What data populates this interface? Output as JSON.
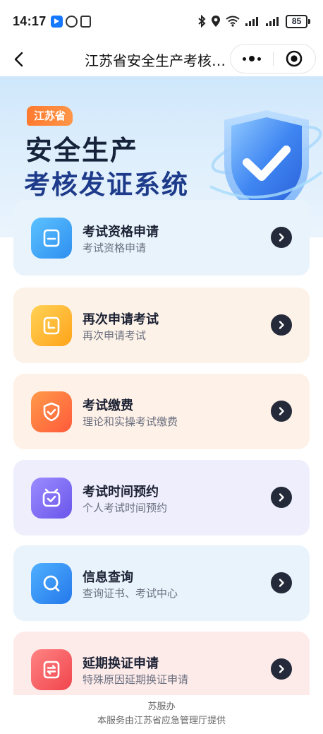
{
  "status_bar": {
    "time": "14:17",
    "battery": "85",
    "icons": [
      "bluetooth-icon",
      "location-icon",
      "wifi-icon",
      "signal-icon",
      "signal-icon"
    ]
  },
  "nav": {
    "title": "江苏省安全生产考核发证系统",
    "back_icon": "chevron-left-icon",
    "more_icon": "more-dots-icon",
    "close_icon": "target-close-icon"
  },
  "banner": {
    "tag": "江苏省",
    "title_line1": "安全生产",
    "title_line2": "考核发证系统"
  },
  "menu": [
    {
      "title": "考试资格申请",
      "subtitle": "考试资格申请",
      "icon": "document-icon",
      "color": "#3aa8f5"
    },
    {
      "title": "再次申请考试",
      "subtitle": "再次申请考试",
      "icon": "calendar-icon",
      "color": "#ffb730"
    },
    {
      "title": "考试缴费",
      "subtitle": "理论和实操考试缴费",
      "icon": "shield-check-icon",
      "color": "#ff6a3d"
    },
    {
      "title": "考试时间预约",
      "subtitle": "个人考试时间预约",
      "icon": "alarm-clock-icon",
      "color": "#7b6af2"
    },
    {
      "title": "信息查询",
      "subtitle": "查询证书、考试中心",
      "icon": "search-icon",
      "color": "#2f8ff0"
    },
    {
      "title": "延期换证申请",
      "subtitle": "特殊原因延期换证申请",
      "icon": "exchange-icon",
      "color": "#f5555a"
    }
  ],
  "footer": {
    "line1": "苏服办",
    "line2": "本服务由江苏省应急管理厅提供"
  }
}
